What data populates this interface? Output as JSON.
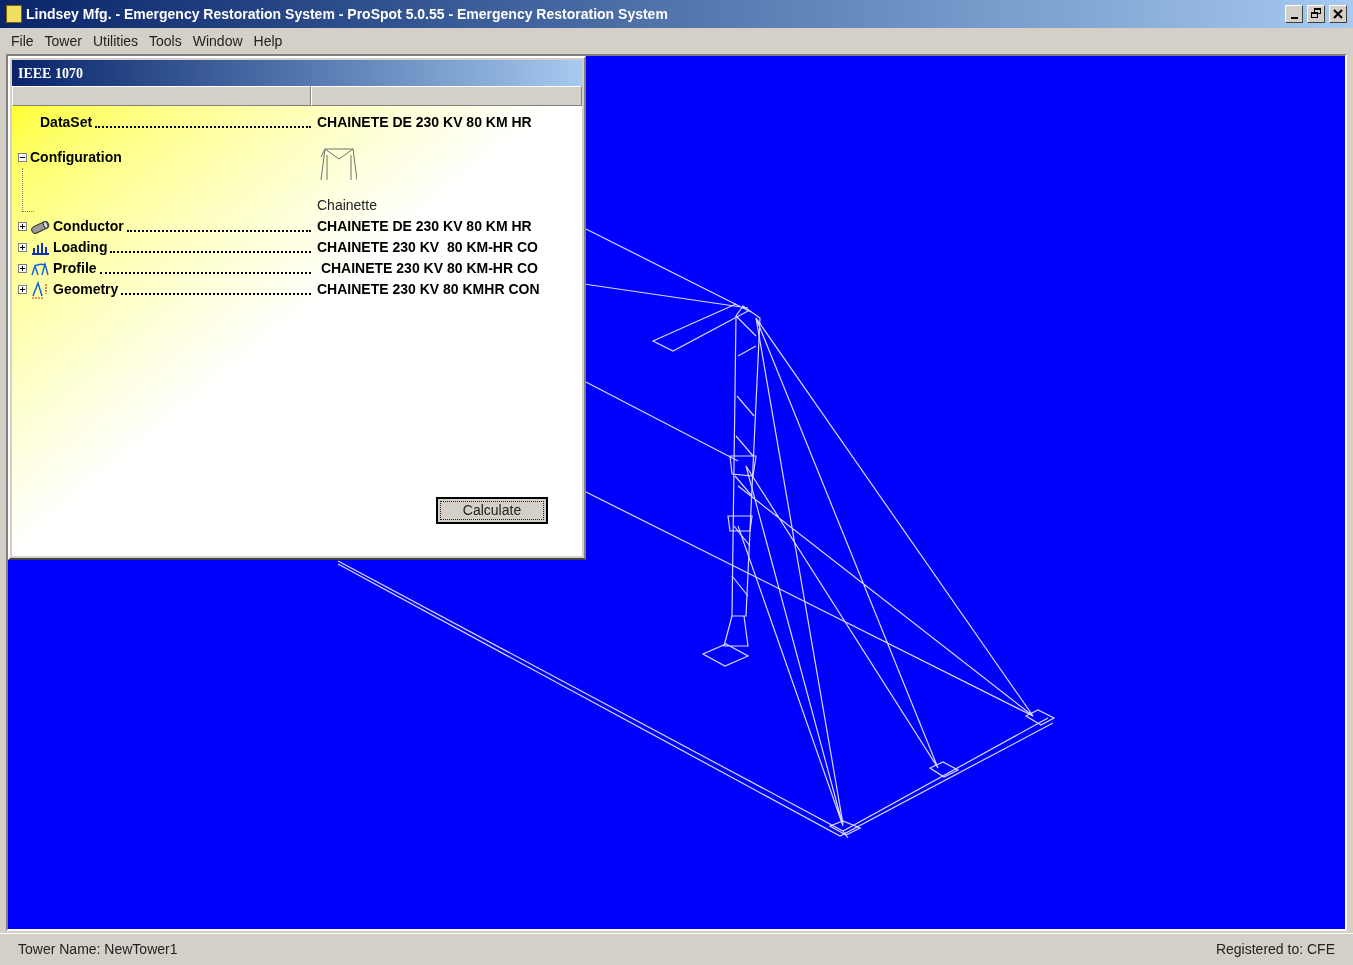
{
  "window": {
    "title": "Lindsey Mfg. - Emergency Restoration System - ProSpot 5.0.55 - Emergency Restoration System"
  },
  "menu": [
    "File",
    "Tower",
    "Utilities",
    "Tools",
    "Window",
    "Help"
  ],
  "dialog": {
    "title": "IEEE 1070",
    "rows": [
      {
        "kind": "plain",
        "label": "DataSet",
        "value": "CHAINETE DE 230 KV 80 KM HR"
      },
      {
        "kind": "image",
        "label": "Configuration",
        "expanded": true,
        "caption": "Chainette"
      },
      {
        "kind": "conductor",
        "label": "Conductor",
        "expanded": false,
        "value": "CHAINETE DE 230 KV 80 KM HR"
      },
      {
        "kind": "loading",
        "label": "Loading",
        "expanded": false,
        "value": "CHAINETE 230 KV  80 KM-HR CO"
      },
      {
        "kind": "profile",
        "label": "Profile",
        "expanded": false,
        "value": " CHAINETE 230 KV 80 KM-HR CO"
      },
      {
        "kind": "geometry",
        "label": "Geometry",
        "expanded": false,
        "value": "CHAINETE 230 KV 80 KMHR CON"
      }
    ],
    "button": "Calculate"
  },
  "status_bar": {
    "left": "Tower Name: NewTower1",
    "right": "Registered to: CFE"
  }
}
